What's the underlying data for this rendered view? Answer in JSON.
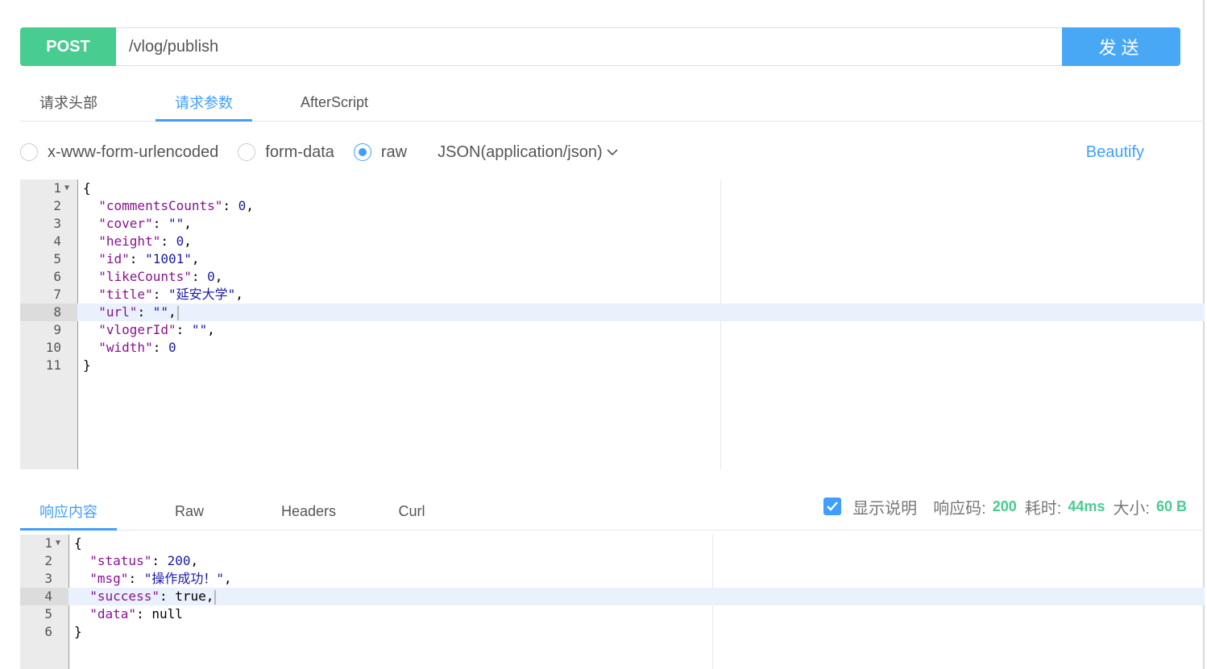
{
  "request": {
    "method": "POST",
    "url": "/vlog/publish",
    "send_label": "发送"
  },
  "request_tabs": [
    {
      "label": "请求头部",
      "active": false
    },
    {
      "label": "请求参数",
      "active": true
    },
    {
      "label": "AfterScript",
      "active": false
    }
  ],
  "body_types": {
    "options": [
      {
        "label": "x-www-form-urlencoded",
        "checked": false
      },
      {
        "label": "form-data",
        "checked": false
      },
      {
        "label": "raw",
        "checked": true
      }
    ],
    "content_type": "JSON(application/json)",
    "beautify_label": "Beautify"
  },
  "request_editor": {
    "active_line": 8,
    "lines": [
      "{",
      "  \"commentsCounts\": 0,",
      "  \"cover\": \"\",",
      "  \"height\": 0,",
      "  \"id\": \"1001\",",
      "  \"likeCounts\": 0,",
      "  \"title\": \"延安大学\",",
      "  \"url\": \"\",",
      "  \"vlogerId\": \"\",",
      "  \"width\": 0",
      "}"
    ]
  },
  "response_tabs": [
    {
      "label": "响应内容",
      "active": true
    },
    {
      "label": "Raw",
      "active": false
    },
    {
      "label": "Headers",
      "active": false
    },
    {
      "label": "Curl",
      "active": false
    }
  ],
  "response_meta": {
    "show_desc_label": "显示说明",
    "show_desc_checked": true,
    "status_label": "响应码:",
    "status_value": "200",
    "time_label": "耗时:",
    "time_value": "44ms",
    "size_label": "大小:",
    "size_value": "60 B"
  },
  "response_editor": {
    "active_line": 4,
    "lines": [
      "{",
      "  \"status\": 200,",
      "  \"msg\": \"操作成功！\",",
      "  \"success\": true,",
      "  \"data\": null",
      "}"
    ]
  },
  "colors": {
    "method_bg": "#49cc90",
    "send_bg": "#49a8f5",
    "accent": "#409eff",
    "meta_value": "#49cc90",
    "json_key": "#881391",
    "json_value": "#1a1aa6"
  }
}
